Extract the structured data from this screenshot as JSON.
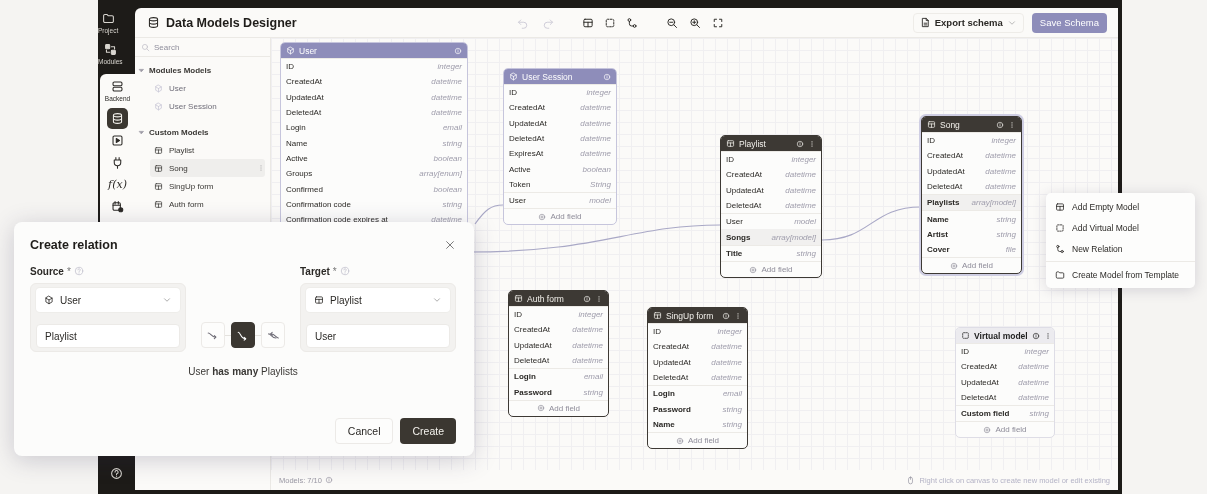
{
  "rail": {
    "items": [
      {
        "label": "Project",
        "kind": "folder",
        "selected": false
      },
      {
        "label": "Modules",
        "kind": "modules",
        "selected": false
      },
      {
        "label": "Backend",
        "kind": "server",
        "selected": true
      }
    ],
    "tools": [
      {
        "kind": "database",
        "selected": true
      },
      {
        "kind": "play",
        "selected": false
      },
      {
        "kind": "plug",
        "selected": false
      },
      {
        "kind": "function",
        "text": "f(x)",
        "selected": false
      },
      {
        "kind": "calendar",
        "selected": false
      }
    ]
  },
  "header": {
    "title": "Data Models Designer",
    "toolbar": [
      {
        "kind": "undo",
        "disabled": true
      },
      {
        "kind": "redo",
        "disabled": true
      },
      {
        "kind": "table",
        "disabled": false
      },
      {
        "kind": "virtual",
        "disabled": false
      },
      {
        "kind": "relation",
        "disabled": false
      },
      {
        "kind": "zoom-out",
        "disabled": false
      },
      {
        "kind": "zoom-in",
        "disabled": false
      },
      {
        "kind": "fullscreen",
        "disabled": false
      }
    ],
    "export_button": "Export schema",
    "save_button": {
      "label": "Save Schema",
      "disabled": true
    }
  },
  "sidebar": {
    "search": {
      "placeholder": "Search"
    },
    "groups": [
      {
        "label": "Modules Models",
        "expanded": true,
        "items": [
          {
            "label": "User",
            "kind": "module",
            "selected": false
          },
          {
            "label": "User Session",
            "kind": "module",
            "selected": false
          }
        ]
      },
      {
        "label": "Custom Models",
        "expanded": true,
        "items": [
          {
            "label": "Playlist",
            "kind": "table",
            "selected": false
          },
          {
            "label": "Song",
            "kind": "table",
            "selected": true
          },
          {
            "label": "SingUp form",
            "kind": "table",
            "selected": false
          },
          {
            "label": "Auth form",
            "kind": "table",
            "selected": false
          }
        ]
      }
    ]
  },
  "models": [
    {
      "title": "User",
      "kind": "module",
      "selected": false,
      "sections": [
        {
          "kind": "system",
          "fields": [
            {
              "name": "ID",
              "type": "integer"
            },
            {
              "name": "CreatedAt",
              "type": "datetime"
            },
            {
              "name": "UpdatedAt",
              "type": "datetime"
            },
            {
              "name": "DeletedAt",
              "type": "datetime"
            },
            {
              "name": "Login",
              "type": "email"
            },
            {
              "name": "Name",
              "type": "string"
            },
            {
              "name": "Active",
              "type": "boolean"
            },
            {
              "name": "Groups",
              "type": "array[enum]"
            },
            {
              "name": "Confirmed",
              "type": "boolean"
            },
            {
              "name": "Confirmation code",
              "type": "string"
            },
            {
              "name": "Confirmation code expires at",
              "type": "datetime"
            }
          ]
        }
      ]
    },
    {
      "title": "User Session",
      "kind": "module",
      "selected": false,
      "add_field": "Add field",
      "sections": [
        {
          "kind": "system",
          "fields": [
            {
              "name": "ID",
              "type": "integer"
            },
            {
              "name": "CreatedAt",
              "type": "datetime"
            },
            {
              "name": "UpdatedAt",
              "type": "datetime"
            },
            {
              "name": "DeletedAt",
              "type": "datetime"
            },
            {
              "name": "ExpiresAt",
              "type": "datetime"
            },
            {
              "name": "Active",
              "type": "boolean"
            },
            {
              "name": "Token",
              "type": "String"
            }
          ]
        },
        {
          "kind": "relation",
          "fields": [
            {
              "name": "User",
              "type": "model",
              "highlighted": false
            }
          ]
        }
      ]
    },
    {
      "title": "Playlist",
      "kind": "custom",
      "selected": false,
      "add_field": "Add field",
      "sections": [
        {
          "kind": "system",
          "fields": [
            {
              "name": "ID",
              "type": "integer"
            },
            {
              "name": "CreatedAt",
              "type": "datetime"
            },
            {
              "name": "UpdatedAt",
              "type": "datetime"
            },
            {
              "name": "DeletedAt",
              "type": "datetime"
            }
          ]
        },
        {
          "kind": "relation",
          "fields": [
            {
              "name": "User",
              "type": "model",
              "highlighted": false
            },
            {
              "name": "Songs",
              "type": "array[model]",
              "highlighted": true
            }
          ]
        },
        {
          "kind": "custom",
          "fields": [
            {
              "name": "Title",
              "type": "string"
            }
          ]
        }
      ]
    },
    {
      "title": "Song",
      "kind": "custom",
      "selected": true,
      "add_field": "Add field",
      "sections": [
        {
          "kind": "system",
          "fields": [
            {
              "name": "ID",
              "type": "integer"
            },
            {
              "name": "CreatedAt",
              "type": "datetime"
            },
            {
              "name": "UpdatedAt",
              "type": "datetime"
            },
            {
              "name": "DeletedAt",
              "type": "datetime"
            }
          ]
        },
        {
          "kind": "relation",
          "fields": [
            {
              "name": "Playlists",
              "type": "array[model]",
              "highlighted": true
            }
          ]
        },
        {
          "kind": "custom",
          "fields": [
            {
              "name": "Name",
              "type": "string"
            },
            {
              "name": "Artist",
              "type": "string"
            },
            {
              "name": "Cover",
              "type": "file"
            }
          ]
        }
      ]
    },
    {
      "title": "Auth form",
      "kind": "custom",
      "selected": false,
      "add_field": "Add field",
      "sections": [
        {
          "kind": "system",
          "fields": [
            {
              "name": "ID",
              "type": "integer"
            },
            {
              "name": "CreatedAt",
              "type": "datetime"
            },
            {
              "name": "UpdatedAt",
              "type": "datetime"
            },
            {
              "name": "DeletedAt",
              "type": "datetime"
            }
          ]
        },
        {
          "kind": "custom",
          "fields": [
            {
              "name": "Login",
              "type": "email"
            },
            {
              "name": "Password",
              "type": "string"
            }
          ]
        }
      ]
    },
    {
      "title": "SingUp form",
      "kind": "custom",
      "selected": false,
      "add_field": "Add field",
      "sections": [
        {
          "kind": "system",
          "fields": [
            {
              "name": "ID",
              "type": "integer"
            },
            {
              "name": "CreatedAt",
              "type": "datetime"
            },
            {
              "name": "UpdatedAt",
              "type": "datetime"
            },
            {
              "name": "DeletedAt",
              "type": "datetime"
            }
          ]
        },
        {
          "kind": "custom",
          "fields": [
            {
              "name": "Login",
              "type": "email"
            },
            {
              "name": "Password",
              "type": "string"
            },
            {
              "name": "Name",
              "type": "string"
            }
          ]
        }
      ]
    },
    {
      "title": "Virtual model",
      "kind": "virtual",
      "selected": false,
      "add_field": "Add field",
      "sections": [
        {
          "kind": "system",
          "fields": [
            {
              "name": "ID",
              "type": "integer"
            },
            {
              "name": "CreatedAt",
              "type": "datetime"
            },
            {
              "name": "UpdatedAt",
              "type": "datetime"
            },
            {
              "name": "DeletedAt",
              "type": "datetime"
            }
          ]
        },
        {
          "kind": "custom",
          "fields": [
            {
              "name": "Custom field",
              "type": "string"
            }
          ]
        }
      ]
    }
  ],
  "status_bar": {
    "models_count": "Models: 7/10",
    "hint": "Right click on canvas to create new model or edit existing"
  },
  "context_menu": {
    "groups": [
      [
        {
          "label": "Add Empty Model",
          "kind": "table"
        },
        {
          "label": "Add Virtual Model",
          "kind": "virtual"
        },
        {
          "label": "New Relation",
          "kind": "relation"
        }
      ],
      [
        {
          "label": "Create Model from Template",
          "kind": "folder"
        }
      ]
    ]
  },
  "dialog": {
    "title": "Create relation",
    "source": {
      "label": "Source",
      "required_mark": "*",
      "select": {
        "value": "User",
        "kind": "module"
      },
      "name_value": "Playlist"
    },
    "target": {
      "label": "Target",
      "required_mark": "*",
      "select": {
        "value": "Playlist",
        "kind": "table"
      },
      "name_value": "User"
    },
    "relation_types": [
      {
        "selected": false
      },
      {
        "selected": true
      },
      {
        "selected": false
      }
    ],
    "summary": "User **has many** Playlists",
    "buttons": [
      {
        "label": "Cancel",
        "kind": "secondary"
      },
      {
        "label": "Create",
        "kind": "primary"
      }
    ]
  }
}
